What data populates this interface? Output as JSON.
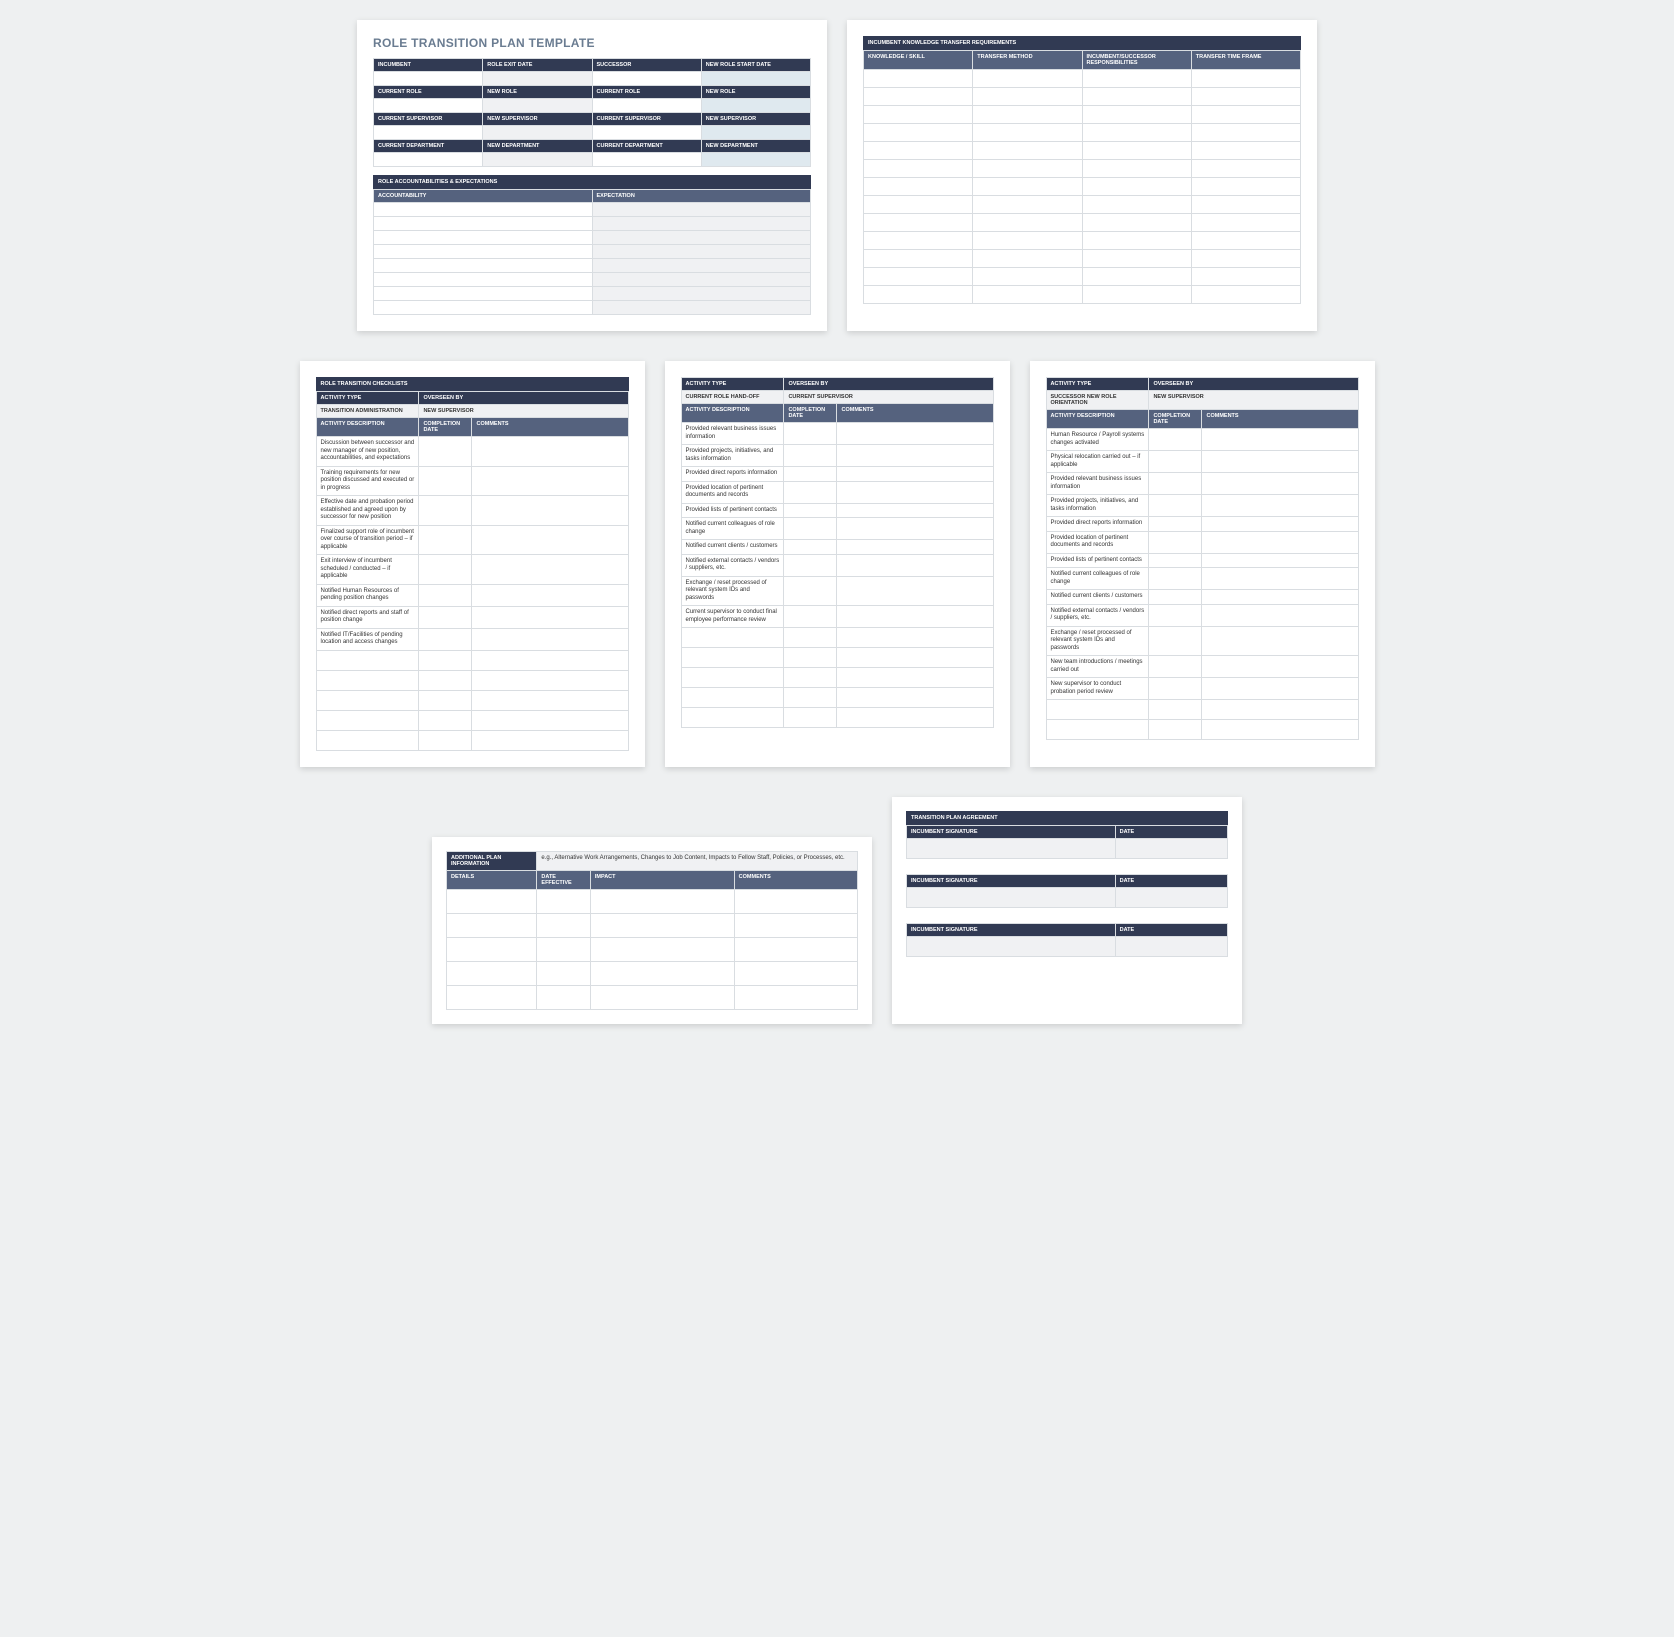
{
  "doc_title": "ROLE TRANSITION PLAN TEMPLATE",
  "info_grid": {
    "r1": [
      "INCUMBENT",
      "ROLE EXIT DATE",
      "SUCCESSOR",
      "NEW ROLE START DATE"
    ],
    "r2": [
      "CURRENT ROLE",
      "NEW ROLE",
      "CURRENT ROLE",
      "NEW ROLE"
    ],
    "r3": [
      "CURRENT SUPERVISOR",
      "NEW SUPERVISOR",
      "CURRENT SUPERVISOR",
      "NEW SUPERVISOR"
    ],
    "r4": [
      "CURRENT DEPARTMENT",
      "NEW DEPARTMENT",
      "CURRENT DEPARTMENT",
      "NEW DEPARTMENT"
    ]
  },
  "accountabilities": {
    "section": "ROLE ACCOUNTABILITIES & EXPECTATIONS",
    "cols": [
      "ACCOUNTABILITY",
      "EXPECTATION"
    ],
    "empty_rows": 8
  },
  "knowledge": {
    "section": "INCUMBENT KNOWLEDGE TRANSFER REQUIREMENTS",
    "cols": [
      "KNOWLEDGE / SKILL",
      "TRANSFER METHOD",
      "INCUMBENT/SUCCESSOR RESPONSIBILITIES",
      "TRANSFER TIME FRAME"
    ],
    "empty_rows": 13
  },
  "checklists": {
    "section": "ROLE TRANSITION CHECKLISTS",
    "type_oversee": [
      "ACTIVITY TYPE",
      "OVERSEEN BY"
    ],
    "cols": [
      "ACTIVITY DESCRIPTION",
      "COMPLETION DATE",
      "COMMENTS"
    ],
    "p1_sub": [
      "TRANSITION ADMINISTRATION",
      "NEW SUPERVISOR"
    ],
    "p1_rows": [
      "Discussion between successor and new manager of new position, accountabilities, and expectations",
      "Training requirements for new position discussed and executed or in progress",
      "Effective date and probation period established and agreed upon by successor for new position",
      "Finalized support role of incumbent over course of transition period – if applicable",
      "Exit interview of incumbent scheduled / conducted – if applicable",
      "Notified Human Resources of pending position changes",
      "Notified direct reports and staff of position change",
      "Notified IT/Facilities of pending location and access changes"
    ],
    "p1_extra": 5,
    "p2_sub": [
      "CURRENT ROLE HAND-OFF",
      "CURRENT SUPERVISOR"
    ],
    "p2_rows": [
      "Provided relevant business issues information",
      "Provided projects, initiatives, and tasks information",
      "Provided direct reports information",
      "Provided location of pertinent documents and records",
      "Provided lists of pertinent contacts",
      "Notified current colleagues of role change",
      "Notified current clients / customers",
      "Notified external contacts / vendors / suppliers, etc.",
      "Exchange / reset processed of relevant system IDs and passwords",
      "Current supervisor to conduct final employee performance review"
    ],
    "p2_extra": 5,
    "p3_sub": [
      "SUCCESSOR NEW ROLE ORIENTATION",
      "NEW SUPERVISOR"
    ],
    "p3_rows": [
      "Human Resource / Payroll systems changes activated",
      "Physical relocation carried out – if applicable",
      "Provided relevant business issues information",
      "Provided projects, initiatives, and tasks information",
      "Provided direct reports information",
      "Provided location of pertinent documents and records",
      "Provided lists of pertinent contacts",
      "Notified current colleagues of role change",
      "Notified current clients / customers",
      "Notified external contacts / vendors / suppliers, etc.",
      "Exchange / reset processed of relevant system IDs and passwords",
      "New team introductions / meetings carried out",
      "New supervisor to conduct probation period review"
    ],
    "p3_extra": 2
  },
  "addl": {
    "section": "ADDITIONAL PLAN INFORMATION",
    "hint": "e.g., Alternative Work Arrangements, Changes to Job Content, Impacts to Fellow Staff, Policies, or Processes, etc.",
    "cols": [
      "DETAILS",
      "DATE EFFECTIVE",
      "IMPACT",
      "COMMENTS"
    ],
    "empty_rows": 5
  },
  "agreement": {
    "section": "TRANSITION PLAN AGREEMENT",
    "rows": [
      [
        "INCUMBENT SIGNATURE",
        "DATE"
      ],
      [
        "INCUMBENT SIGNATURE",
        "DATE"
      ],
      [
        "INCUMBENT SIGNATURE",
        "DATE"
      ]
    ]
  }
}
